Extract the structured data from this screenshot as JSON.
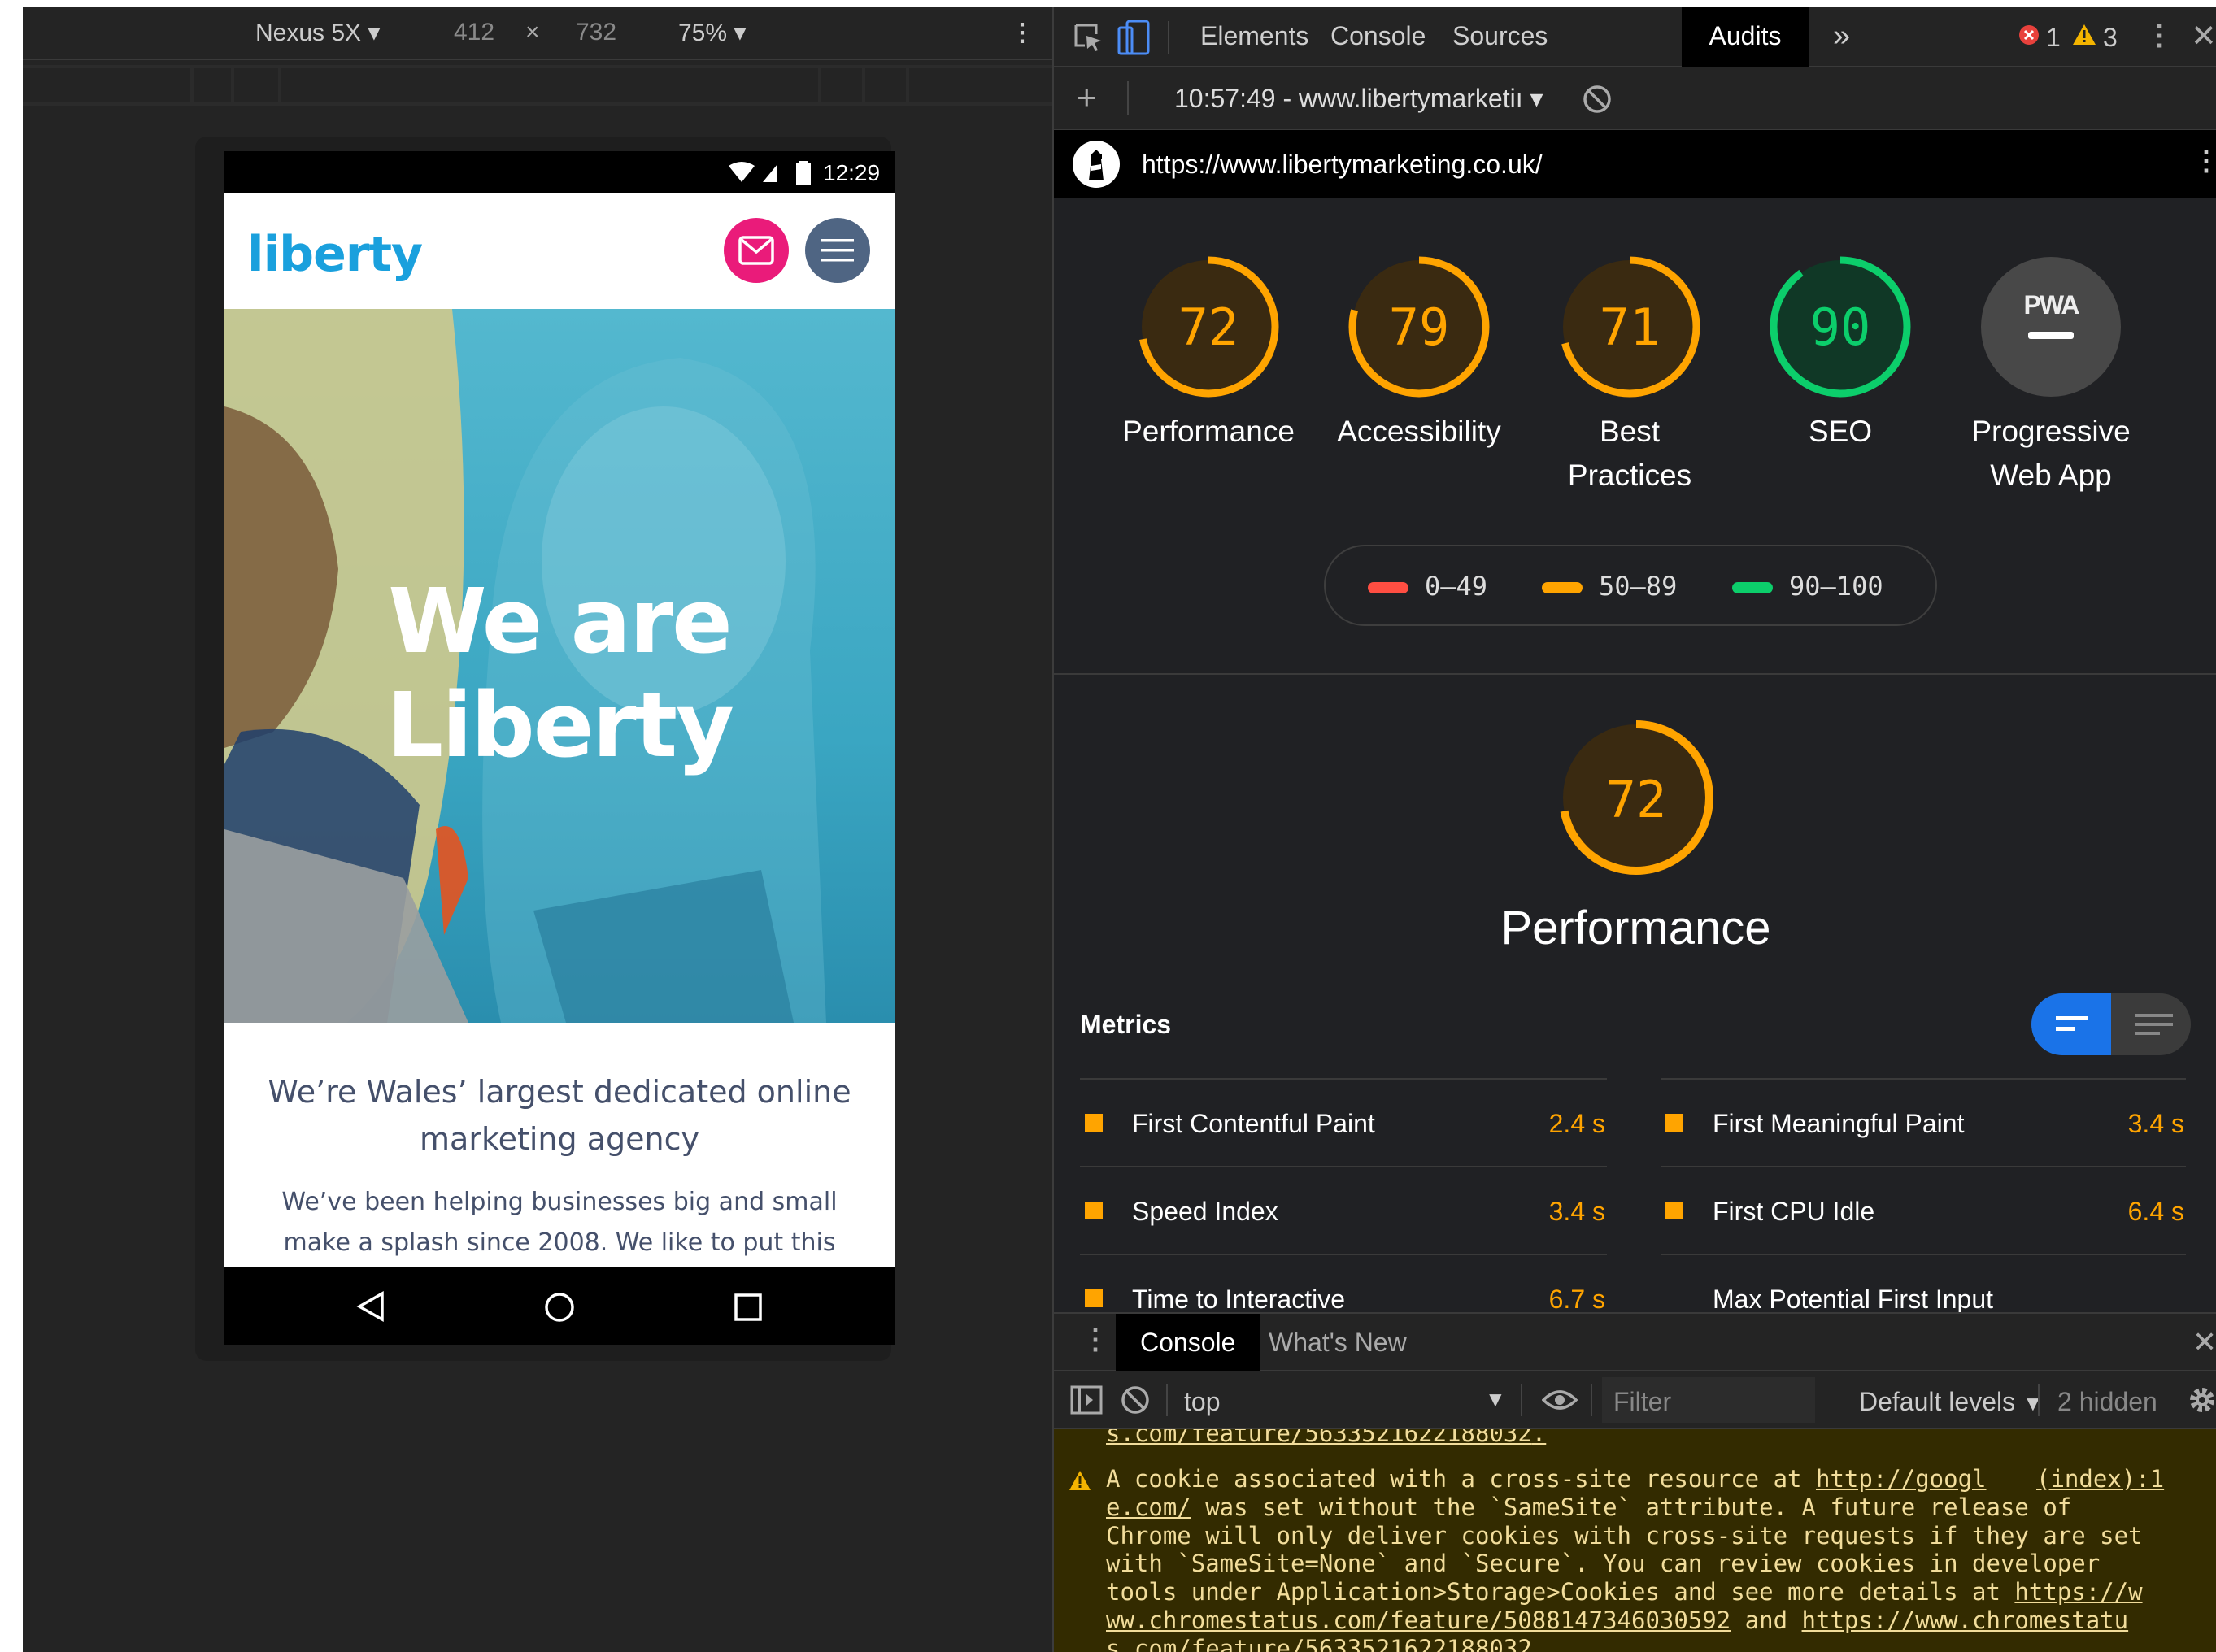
{
  "device_toolbar": {
    "device": "Nexus 5X",
    "width": "412",
    "times": "×",
    "height": "732",
    "zoom": "75%"
  },
  "phone": {
    "time": "12:29",
    "logo": "liberty",
    "hero_title_line1": "We are",
    "hero_title_line2": "Liberty",
    "headline": "We’re Wales’ largest dedicated online marketing agency",
    "body": "We’ve been helping businesses big and small make a splash since 2008. We like to put this"
  },
  "devtools": {
    "tabs": [
      "Elements",
      "Console",
      "Sources",
      "Audits"
    ],
    "more": "»",
    "error_count": "1",
    "warning_count": "3",
    "run_label": "10:57:49 - www.libertymarketiı",
    "url": "https://www.libertymarketing.co.uk/"
  },
  "scores": [
    {
      "label_line1": "Performance",
      "label_line2": "",
      "score": 72,
      "color": "#ffa400"
    },
    {
      "label_line1": "Accessibility",
      "label_line2": "",
      "score": 79,
      "color": "#ffa400"
    },
    {
      "label_line1": "Best",
      "label_line2": "Practices",
      "score": 71,
      "color": "#ffa400"
    },
    {
      "label_line1": "SEO",
      "label_line2": "",
      "score": 90,
      "color": "#0cce6b"
    },
    {
      "label_line1": "Progressive",
      "label_line2": "Web App",
      "badge": "PWA"
    }
  ],
  "legend": [
    {
      "range": "0–49",
      "color": "#ff4e42"
    },
    {
      "range": "50–89",
      "color": "#ffa400"
    },
    {
      "range": "90–100",
      "color": "#0cce6b"
    }
  ],
  "performance": {
    "score": 72,
    "title": "Performance",
    "metrics_title": "Metrics"
  },
  "metrics": [
    {
      "name": "First Contentful Paint",
      "value": "2.4 s"
    },
    {
      "name": "First Meaningful Paint",
      "value": "3.4 s"
    },
    {
      "name": "Speed Index",
      "value": "3.4 s"
    },
    {
      "name": "First CPU Idle",
      "value": "6.4 s"
    },
    {
      "name": "Time to Interactive",
      "value": "6.7 s"
    },
    {
      "name": "Max Potential First Input",
      "value": ""
    }
  ],
  "drawer": {
    "tabs": [
      "Console",
      "What's New"
    ],
    "context": "top",
    "filter_placeholder": "Filter",
    "levels": "Default levels",
    "hidden": "2 hidden",
    "prev_link": "s.com/feature/5633521622188032",
    "prev_tail": ".",
    "msg_source": "(index):1",
    "msg_l1_a": "A cookie associated with a cross-site resource at ",
    "msg_l1_link": "http://googl",
    "msg_l2_link": "e.com/",
    "msg_l2_b": " was set without the `SameSite` attribute. A future release of",
    "msg_l3": "Chrome will only deliver cookies with cross-site requests if they are set",
    "msg_l4": "with `SameSite=None` and `Secure`. You can review cookies in developer",
    "msg_l5_a": "tools under Application>Storage>Cookies and see more details at ",
    "msg_l5_link": "https://w",
    "msg_l6_link": "ww.chromestatus.com/feature/5088147346030592",
    "msg_l6_b": " and ",
    "msg_l6_link2": "https://www.chromestatu",
    "msg_l7_link": "s.com/feature/5633521622188032",
    "msg_l7_b": "."
  }
}
